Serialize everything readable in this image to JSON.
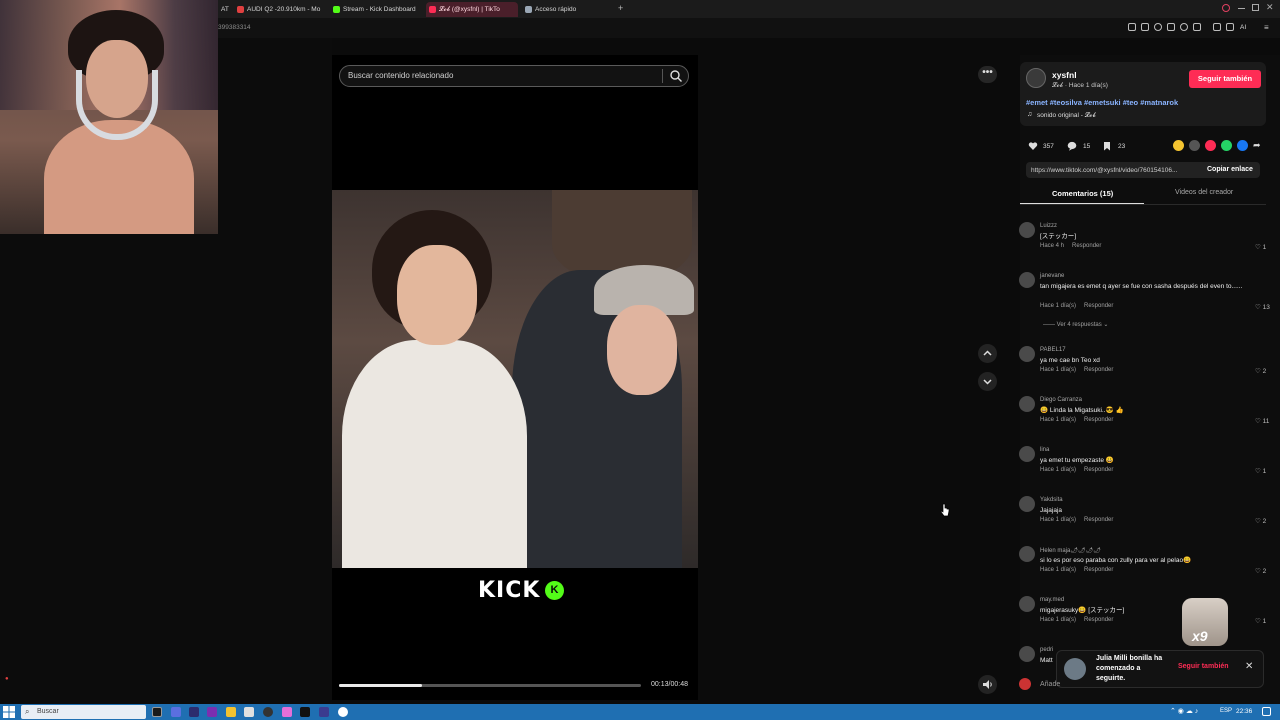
{
  "browser": {
    "tabs": [
      {
        "label": "AT",
        "color": "#888888"
      },
      {
        "label": "AUDI Q2 -20.910km - Mo",
        "color": "#e04040"
      },
      {
        "label": "Stream - Kick Dashboard",
        "color": "#53fc18"
      },
      {
        "label": "𝓛𝓸𝓫 (@xysfnl) | TikTo",
        "color": "#fe2c55",
        "active": true
      },
      {
        "label": "Acceso rápido",
        "color": "#9aa7b5"
      }
    ],
    "new_tab": "+",
    "url_tail": "399383314",
    "ai_label": "AI"
  },
  "search": {
    "placeholder": "Buscar contenido relacionado"
  },
  "video": {
    "overlay_brand": "KICK",
    "overlay_badge": "K",
    "time": "00:13/00:48",
    "progress": 0.275
  },
  "author": {
    "name": "xysfnl",
    "sub": "𝓛𝓸𝓫 · Hace 1 día(s)",
    "follow_label": "Seguir también",
    "hashtags": "#emet #teosilva #emetsuki #teo #matnarok",
    "sound": "sonido original - 𝓛𝓸𝓫"
  },
  "stats": {
    "likes": "357",
    "comments": "15",
    "saves": "23"
  },
  "share_colors": [
    "#f4c430",
    "#555555",
    "#fe2c55",
    "#25d366",
    "#1877f2"
  ],
  "link": {
    "url": "https://www.tiktok.com/@xysfnl/video/760154106...",
    "copy_label": "Copiar enlace"
  },
  "tabs": {
    "comments": "Comentarios (15)",
    "creator": "Videos del creador"
  },
  "comments": [
    {
      "user": "Luizzz",
      "text": "[ステッカー]",
      "time": "Hace 4 h",
      "reply": "Responder",
      "likes": "1"
    },
    {
      "user": "janevane",
      "text": "tan migajera es emet q ayer se fue con sasha después del even to......",
      "time": "Hace 1 día(s)",
      "reply": "Responder",
      "likes": "13"
    },
    {
      "user": "PABEL17",
      "text": "ya me cae bn Teo xd",
      "time": "Hace 1 día(s)",
      "reply": "Responder",
      "likes": "2"
    },
    {
      "user": "Diego Carranza",
      "text": "😀 Linda la Migatsuki..😎 👍",
      "time": "Hace 1 día(s)",
      "reply": "Responder",
      "likes": "11"
    },
    {
      "user": "lina",
      "text": "ya emet tu empezaste 😀",
      "time": "Hace 1 día(s)",
      "reply": "Responder",
      "likes": "1"
    },
    {
      "user": "Yakdsita",
      "text": "Jajajaja",
      "time": "Hace 1 día(s)",
      "reply": "Responder",
      "likes": "2"
    },
    {
      "user": "Helen maja🌶🌶🌶🌶",
      "text": "si lo es por eso paraba con zully para ver al pelao😀",
      "time": "Hace 1 día(s)",
      "reply": "Responder",
      "likes": "2"
    },
    {
      "user": "may.med",
      "text": "migajerasuky😀 [ステッカー]",
      "time": "Hace 1 día(s)",
      "reply": "Responder",
      "likes": "1"
    },
    {
      "user": "pedri",
      "text": "Matt",
      "time": "",
      "reply": "",
      "likes": ""
    }
  ],
  "replies_label": "Ver 4 respuestas ⌄",
  "sticker_label": "x9",
  "notification": {
    "text": "Julia Milli bonilla ha comenzado a seguirte.",
    "follow": "Seguir también",
    "close": "✕"
  },
  "add_comment": "Añade",
  "taskbar": {
    "search": "Buscar",
    "lang": "ESP",
    "time": "22:36"
  }
}
